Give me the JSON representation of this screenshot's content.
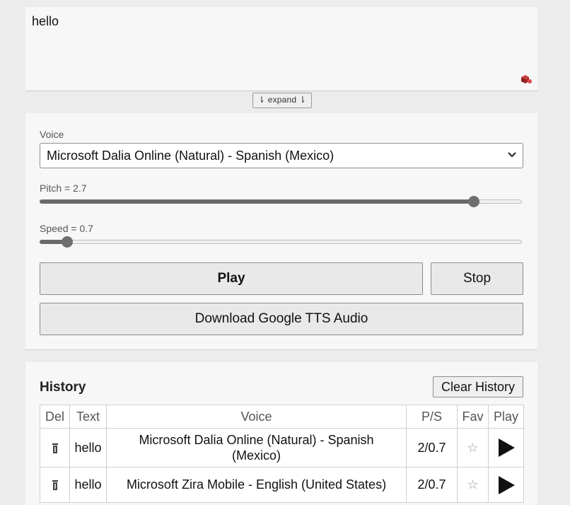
{
  "textarea": {
    "value": "hello"
  },
  "expand": {
    "label": "⇂ expand ⇂"
  },
  "voice": {
    "label": "Voice",
    "selected": "Microsoft Dalia Online (Natural) - Spanish (Mexico)"
  },
  "pitch": {
    "label": "Pitch = 2.7",
    "value": 2.7,
    "min": 0,
    "max": 3
  },
  "speed": {
    "label": "Speed = 0.7",
    "value": 0.7,
    "min": 0.5,
    "max": 4
  },
  "buttons": {
    "play": "Play",
    "stop": "Stop",
    "download": "Download Google TTS Audio"
  },
  "history": {
    "title": "History",
    "clear_label": "Clear History",
    "columns": [
      "Del",
      "Text",
      "Voice",
      "P/S",
      "Fav",
      "Play"
    ],
    "rows": [
      {
        "text": "hello",
        "voice": "Microsoft Dalia Online (Natural) - Spanish (Mexico)",
        "ps": "2/0.7",
        "fav": "☆"
      },
      {
        "text": "hello",
        "voice": "Microsoft Zira Mobile - English (United States)",
        "ps": "2/0.7",
        "fav": "☆"
      }
    ]
  },
  "icons": {
    "grip": "resize-grip-icon",
    "select": "chevron-down-icon",
    "delete": "trash-icon",
    "favorite": "star-icon",
    "play": "play-icon"
  },
  "colors": {
    "slider_fill": "#6a6a6a",
    "panel": "#f7f7f7",
    "background": "#ececec"
  }
}
